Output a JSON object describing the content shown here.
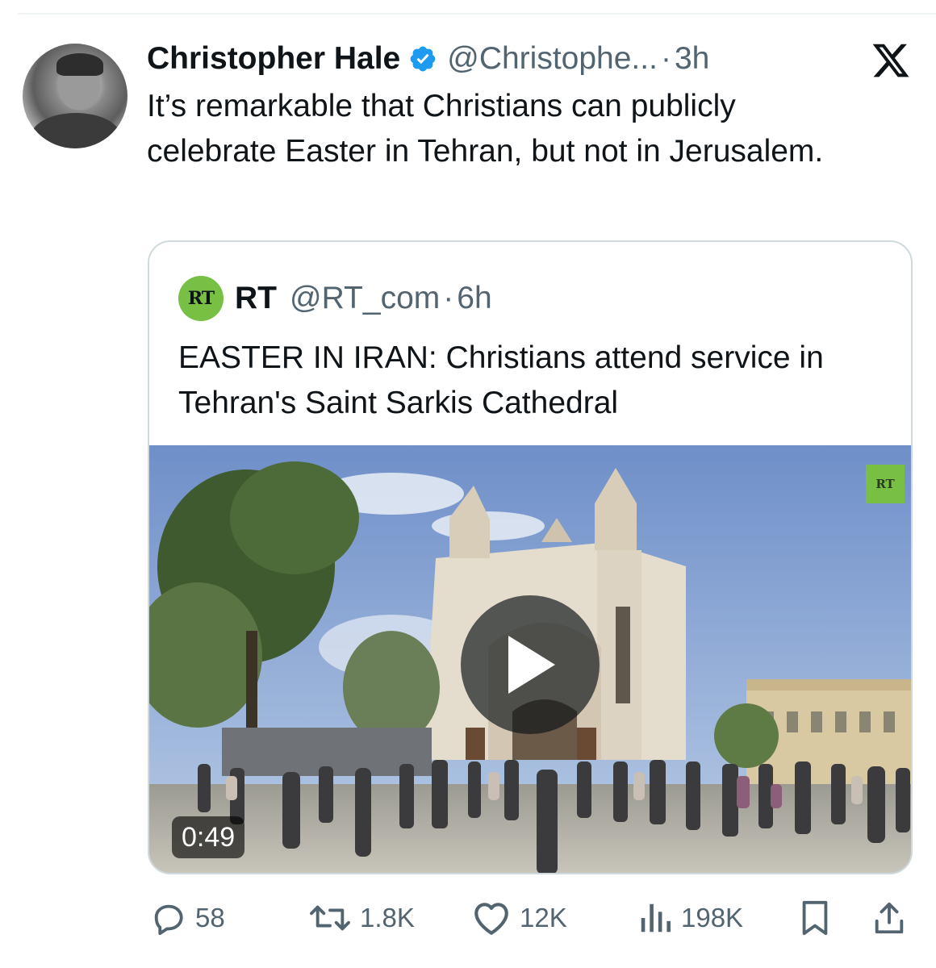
{
  "author": {
    "display_name": "Christopher Hale",
    "handle": "@Christophe...",
    "separator": "·",
    "time": "3h"
  },
  "tweet": {
    "text": "It’s remarkable that Christians can publicly celebrate Easter in Tehran, but not in Jerusalem."
  },
  "quote": {
    "badge": "RT",
    "name": "RT",
    "handle": "@RT_com",
    "separator": "·",
    "time": "6h",
    "text": "EASTER IN IRAN: Christians attend service in Tehran's Saint Sarkis Cathedral",
    "media": {
      "watermark": "RT",
      "duration": "0:49"
    }
  },
  "actions": {
    "replies": "58",
    "reposts": "1.8K",
    "likes": "12K",
    "views": "198K"
  },
  "colors": {
    "text": "#0f1419",
    "muted": "#536471",
    "verified": "#1d9bf0",
    "rt_green": "#77c043",
    "border": "#cfd9de"
  },
  "icons": [
    "verified-icon",
    "x-logo-icon",
    "play-icon",
    "reply-icon",
    "repost-icon",
    "like-icon",
    "views-icon",
    "bookmark-icon",
    "share-icon"
  ]
}
